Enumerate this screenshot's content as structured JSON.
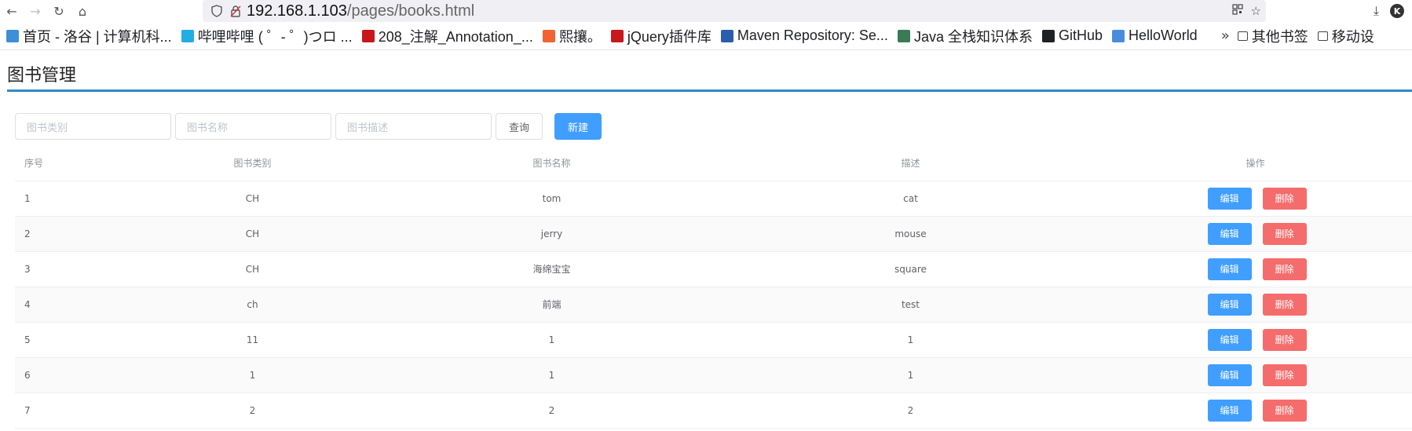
{
  "browser": {
    "url_host": "192.168.1.103",
    "url_path": "/pages/books.html",
    "avatar_letter": "K",
    "bookmarks": [
      {
        "label": "首页 - 洛谷 | 计算机科...",
        "icon": "luogu-icon",
        "color": "#3e8ed8"
      },
      {
        "label": "哔哩哔哩 ( ゜- ゜)つロ ...",
        "icon": "bilibili-icon",
        "color": "#23ade5"
      },
      {
        "label": "208_注解_Annotation_...",
        "icon": "speed-icon",
        "color": "#c7161c"
      },
      {
        "label": "熙攘。",
        "icon": "csdn-icon",
        "color": "#f26334"
      },
      {
        "label": "jQuery插件库",
        "icon": "jquery-icon",
        "color": "#c9171e"
      },
      {
        "label": "Maven Repository: Se...",
        "icon": "maven-icon",
        "color": "#2a5db0"
      },
      {
        "label": "Java 全栈知识体系",
        "icon": "java-icon",
        "color": "#3b7a57"
      },
      {
        "label": "GitHub",
        "icon": "github-icon",
        "color": "#202124"
      },
      {
        "label": "HelloWorld",
        "icon": "hello-icon",
        "color": "#4a8be0"
      }
    ],
    "other_bookmarks": "其他书签",
    "mobile_bookmarks": "移动设"
  },
  "page": {
    "title": "图书管理",
    "search": {
      "type_placeholder": "图书类别",
      "name_placeholder": "图书名称",
      "desc_placeholder": "图书描述",
      "query_label": "查询",
      "new_label": "新建"
    },
    "table": {
      "headers": [
        "序号",
        "图书类别",
        "图书名称",
        "描述",
        "操作"
      ],
      "edit_label": "编辑",
      "delete_label": "删除",
      "rows": [
        {
          "idx": "1",
          "type": "CH",
          "name": "tom",
          "desc": "cat"
        },
        {
          "idx": "2",
          "type": "CH",
          "name": "jerry",
          "desc": "mouse"
        },
        {
          "idx": "3",
          "type": "CH",
          "name": "海绵宝宝",
          "desc": "square"
        },
        {
          "idx": "4",
          "type": "ch",
          "name": "前端",
          "desc": "test"
        },
        {
          "idx": "5",
          "type": "11",
          "name": "1",
          "desc": "1"
        },
        {
          "idx": "6",
          "type": "1",
          "name": "1",
          "desc": "1"
        },
        {
          "idx": "7",
          "type": "2",
          "name": "2",
          "desc": "2"
        }
      ]
    }
  },
  "colors": {
    "primary": "#409eff",
    "danger": "#f56c6c",
    "title_rule": "#2f8bc9"
  }
}
